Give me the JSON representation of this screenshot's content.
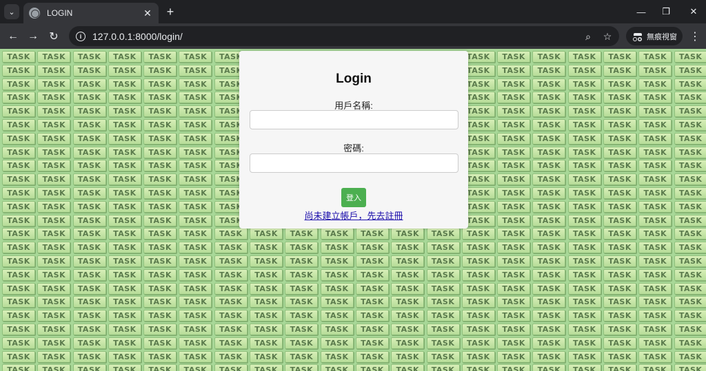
{
  "browser": {
    "tab_title": "LOGIN",
    "url": "127.0.0.1:8000/login/",
    "incognito_label": "無痕視窗"
  },
  "background": {
    "tile_text": "TASK",
    "color": "#a8d898"
  },
  "login": {
    "title": "Login",
    "username_label": "用戶名稱:",
    "username_value": "",
    "password_label": "密碼:",
    "password_value": "",
    "submit_label": "登入",
    "register_link": "尚未建立帳戶，先去註冊",
    "accent": "#4caf50"
  }
}
